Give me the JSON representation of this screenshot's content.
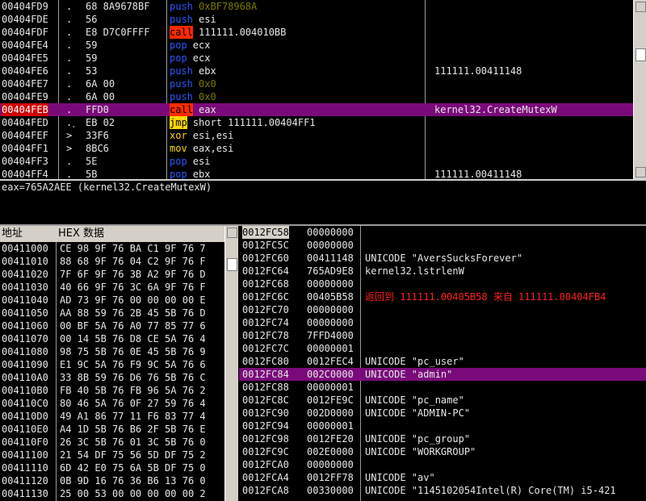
{
  "disasm": {
    "rows": [
      {
        "addr": "00404FD9",
        "mark": ".",
        "hex": "68 8A9678BF",
        "mnemonic": "push",
        "operand": "0xBF78968A",
        "comment": "",
        "mclass": "m-push",
        "oclass": "opd-dim"
      },
      {
        "addr": "00404FDE",
        "mark": ".",
        "hex": "56",
        "mnemonic": "push",
        "operand": "esi",
        "comment": "",
        "mclass": "m-push",
        "oclass": "opd-reg"
      },
      {
        "addr": "00404FDF",
        "mark": ".",
        "hex": "E8 D7C0FFFF",
        "mnemonic": "call",
        "operand": "111111.004010BB",
        "comment": "",
        "mclass": "m-call",
        "oclass": "opd-reg"
      },
      {
        "addr": "00404FE4",
        "mark": ".",
        "hex": "59",
        "mnemonic": "pop",
        "operand": "ecx",
        "comment": "",
        "mclass": "m-pop",
        "oclass": "opd-reg"
      },
      {
        "addr": "00404FE5",
        "mark": ".",
        "hex": "59",
        "mnemonic": "pop",
        "operand": "ecx",
        "comment": "",
        "mclass": "m-pop",
        "oclass": "opd-reg"
      },
      {
        "addr": "00404FE6",
        "mark": ".",
        "hex": "53",
        "mnemonic": "push",
        "operand": "ebx",
        "comment": "111111.00411148",
        "mclass": "m-push",
        "oclass": "opd-reg"
      },
      {
        "addr": "00404FE7",
        "mark": ".",
        "hex": "6A 00",
        "mnemonic": "push",
        "operand": "0x0",
        "comment": "",
        "mclass": "m-push",
        "oclass": "opd-dim"
      },
      {
        "addr": "00404FE9",
        "mark": ".",
        "hex": "6A 00",
        "mnemonic": "push",
        "operand": "0x0",
        "comment": "",
        "mclass": "m-push",
        "oclass": "opd-dim"
      },
      {
        "addr": "00404FEB",
        "mark": ".",
        "hex": "FFD0",
        "mnemonic": "call",
        "operand": "eax",
        "comment": "kernel32.CreateMutexW",
        "mclass": "m-call",
        "oclass": "opd-reg",
        "selected": true
      },
      {
        "addr": "00404FED",
        "mark": ".˯",
        "hex": "EB 02",
        "mnemonic": "jmp",
        "operand": "short 111111.00404FF1",
        "comment": "",
        "mclass": "m-jmp",
        "oclass": "opd-reg"
      },
      {
        "addr": "00404FEF",
        "mark": ">",
        "hex": "33F6",
        "mnemonic": "xor",
        "operand": "esi,esi",
        "comment": "",
        "mclass": "m-xor",
        "oclass": "opd-reg"
      },
      {
        "addr": "00404FF1",
        "mark": ">",
        "hex": "8BC6",
        "mnemonic": "mov",
        "operand": "eax,esi",
        "comment": "",
        "mclass": "m-mov",
        "oclass": "opd-reg"
      },
      {
        "addr": "00404FF3",
        "mark": ".",
        "hex": "5E",
        "mnemonic": "pop",
        "operand": "esi",
        "comment": "",
        "mclass": "m-pop",
        "oclass": "opd-reg"
      },
      {
        "addr": "00404FF4",
        "mark": ".",
        "hex": "5B",
        "mnemonic": "pop",
        "operand": "ebx",
        "comment": "111111.00411148",
        "mclass": "m-pop",
        "oclass": "opd-reg"
      }
    ]
  },
  "info": {
    "text": "eax=765A2AEE (kernel32.CreateMutexW)"
  },
  "dump": {
    "header_addr": "地址",
    "header_hex": "HEX 数据",
    "rows": [
      {
        "addr": "00411000",
        "hex": "CE 98 9F 76 BA C1 9F 76 7"
      },
      {
        "addr": "00411010",
        "hex": "88 68 9F 76 04 C2 9F 76 F"
      },
      {
        "addr": "00411020",
        "hex": "7F 6F 9F 76 3B A2 9F 76 D"
      },
      {
        "addr": "00411030",
        "hex": "40 66 9F 76 3C 6A 9F 76 F"
      },
      {
        "addr": "00411040",
        "hex": "AD 73 9F 76 00 00 00 00 E"
      },
      {
        "addr": "00411050",
        "hex": "AA 88 59 76 2B 45 5B 76 D"
      },
      {
        "addr": "00411060",
        "hex": "00 BF 5A 76 A0 77 85 77 6"
      },
      {
        "addr": "00411070",
        "hex": "00 14 5B 76 D8 CE 5A 76 4"
      },
      {
        "addr": "00411080",
        "hex": "98 75 5B 76 0E 45 5B 76 9"
      },
      {
        "addr": "00411090",
        "hex": "E1 9C 5A 76 F9 9C 5A 76 6"
      },
      {
        "addr": "004110A0",
        "hex": "33 8B 59 76 D6 76 5B 76 C"
      },
      {
        "addr": "004110B0",
        "hex": "FB 40 5B 76 FB 96 5A 76 2"
      },
      {
        "addr": "004110C0",
        "hex": "80 46 5A 76 0F 27 59 76 4"
      },
      {
        "addr": "004110D0",
        "hex": "49 A1 86 77 11 F6 83 77 4"
      },
      {
        "addr": "004110E0",
        "hex": "A4 1D 5B 76 B6 2F 5B 76 E"
      },
      {
        "addr": "004110F0",
        "hex": "26 3C 5B 76 01 3C 5B 76 0"
      },
      {
        "addr": "00411100",
        "hex": "21 54 DF 75 56 5D DF 75 2"
      },
      {
        "addr": "00411110",
        "hex": "6D 42 E0 75 6A 5B DF 75 0"
      },
      {
        "addr": "00411120",
        "hex": "0B 9D 16 76 36 B6 13 76 0"
      },
      {
        "addr": "00411130",
        "hex": "25 00 53 00 00 00 00 00 2"
      }
    ]
  },
  "stack": {
    "rows": [
      {
        "addr": "0012FC58",
        "val": "00000000",
        "comment": "",
        "top": true
      },
      {
        "addr": "0012FC5C",
        "val": "00000000",
        "comment": ""
      },
      {
        "addr": "0012FC60",
        "val": "00411148",
        "comment": "UNICODE \"AversSucksForever\""
      },
      {
        "addr": "0012FC64",
        "val": "765AD9E8",
        "comment": "kernel32.lstrlenW"
      },
      {
        "addr": "0012FC68",
        "val": "00000000",
        "comment": ""
      },
      {
        "addr": "0012FC6C",
        "val": "00405B58",
        "comment": "返回到 111111.00405B58 来自 111111.00404FB4",
        "red": true
      },
      {
        "addr": "0012FC70",
        "val": "00000000",
        "comment": ""
      },
      {
        "addr": "0012FC74",
        "val": "00000000",
        "comment": ""
      },
      {
        "addr": "0012FC78",
        "val": "7FFD4000",
        "comment": ""
      },
      {
        "addr": "0012FC7C",
        "val": "00000001",
        "comment": ""
      },
      {
        "addr": "0012FC80",
        "val": "0012FEC4",
        "comment": "UNICODE \"pc_user\""
      },
      {
        "addr": "0012FC84",
        "val": "002C0000",
        "comment": "UNICODE \"admin\"",
        "selected": true
      },
      {
        "addr": "0012FC88",
        "val": "00000001",
        "comment": ""
      },
      {
        "addr": "0012FC8C",
        "val": "0012FE9C",
        "comment": "UNICODE \"pc_name\""
      },
      {
        "addr": "0012FC90",
        "val": "002D0000",
        "comment": "UNICODE \"ADMIN-PC\""
      },
      {
        "addr": "0012FC94",
        "val": "00000001",
        "comment": ""
      },
      {
        "addr": "0012FC98",
        "val": "0012FE20",
        "comment": "UNICODE \"pc_group\""
      },
      {
        "addr": "0012FC9C",
        "val": "002E0000",
        "comment": "UNICODE \"WORKGROUP\""
      },
      {
        "addr": "0012FCA0",
        "val": "00000000",
        "comment": ""
      },
      {
        "addr": "0012FCA4",
        "val": "0012FF78",
        "comment": "UNICODE \"av\""
      },
      {
        "addr": "0012FCA8",
        "val": "00330000",
        "comment": "UNICODE \"1145102054Intel(R) Core(TM) i5-421"
      }
    ]
  }
}
